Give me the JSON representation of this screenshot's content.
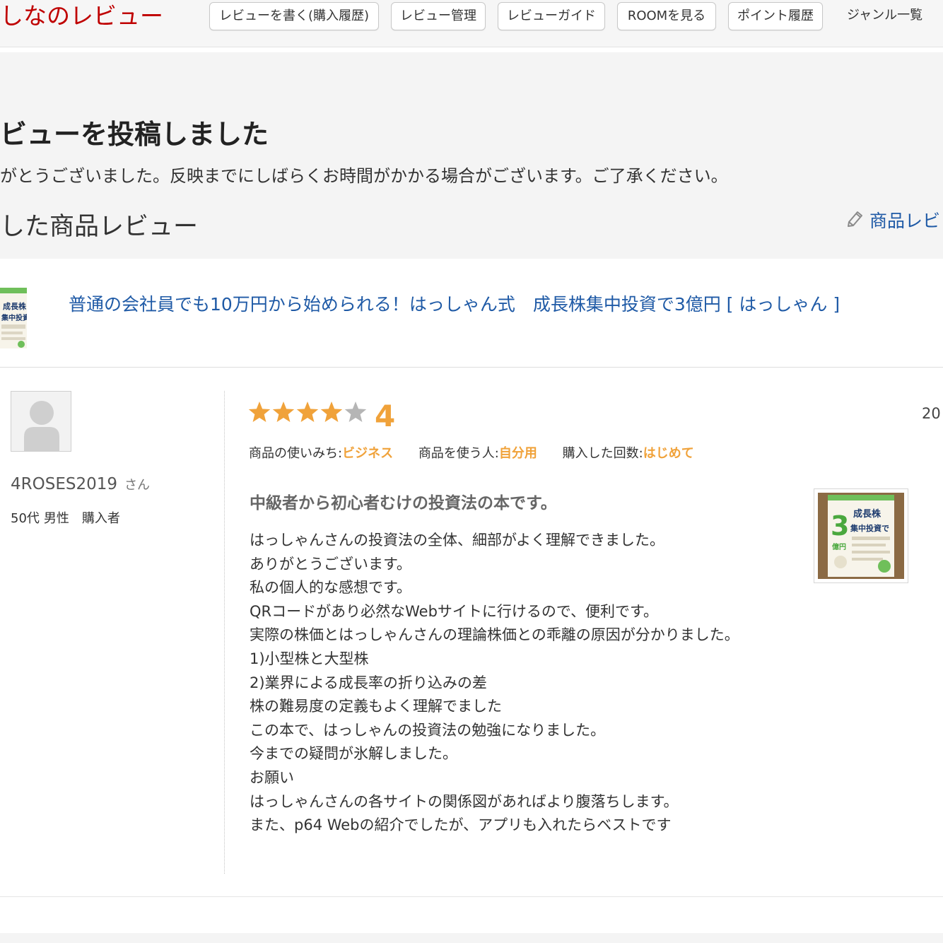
{
  "header": {
    "brand_text": "しなのレビュー",
    "nav": [
      {
        "label": "レビューを書く(購入履歴)"
      },
      {
        "label": "レビュー管理"
      },
      {
        "label": "レビューガイド"
      },
      {
        "label": "ROOMを見る"
      },
      {
        "label": "ポイント履歴"
      },
      {
        "label": "ジャンル一覧"
      }
    ]
  },
  "posted": {
    "title": "ビューを投稿しました",
    "message": "がとうございました。反映までにしばらくお時間がかかる場合がございます。ご了承ください。",
    "section_title": "した商品レビュー",
    "write_link": "商品レビ"
  },
  "product": {
    "title_link": "普通の会社員でも10万円から始められる！はっしゃん式　成長株集中投資で3億円 [ はっしゃん ]",
    "cover_text": [
      "成長株",
      "集中投資で",
      "3",
      "億円"
    ]
  },
  "review": {
    "reviewer_name": "4ROSES2019",
    "honorific": "さん",
    "age": "50代",
    "gender": "男性",
    "buyer_label": "購入者",
    "rating": 4,
    "rating_max": 5,
    "rating_text": "4",
    "date_partial": "20",
    "attributes": [
      {
        "label": "商品の使いみち:",
        "value": "ビジネス"
      },
      {
        "label": "商品を使う人:",
        "value": "自分用"
      },
      {
        "label": "購入した回数:",
        "value": "はじめて"
      }
    ],
    "title": "中級者から初心者むけの投資法の本です。",
    "body_lines": [
      "はっしゃんさんの投資法の全体、細部がよく理解できました。",
      "ありがとうございます。",
      "私の個人的な感想です。",
      "QRコードがあり必然なWebサイトに行けるので、便利です。",
      "実際の株価とはっしゃんさんの理論株価との乖離の原因が分かりました。",
      "1)小型株と大型株",
      "2)業界による成長率の折り込みの差",
      "株の難易度の定義もよく理解でました",
      "この本で、はっしゃんの投資法の勉強になりました。",
      "今までの疑問が氷解しました。",
      "お願い",
      "はっしゃんさんの各サイトの関係図があればより腹落ちします。",
      "また、p64 Webの紹介でしたが、アプリも入れたらベストです"
    ]
  },
  "colors": {
    "brand_red": "#bf0000",
    "link_blue": "#1f5aa6",
    "star_orange": "#f0a23a",
    "star_gray": "#b5b5b5",
    "panel_gray": "#f4f4f4"
  },
  "icons": {
    "write": "pencil-icon",
    "avatar": "default-avatar-icon",
    "star": "star-icon"
  }
}
